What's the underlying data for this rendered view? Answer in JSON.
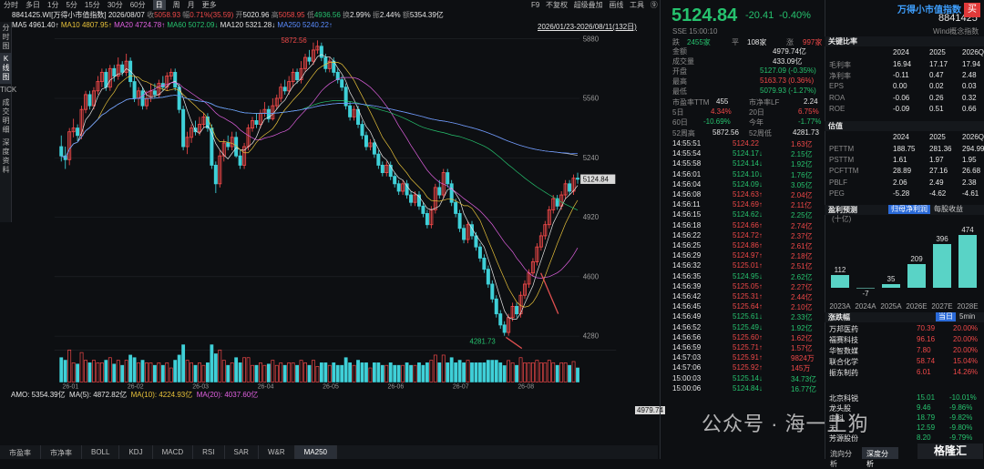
{
  "top_tabs": [
    "分时",
    "多日",
    "1分",
    "5分",
    "15分",
    "30分",
    "60分",
    "日",
    "周",
    "月",
    "更多"
  ],
  "top_right": [
    "F9",
    "不复权",
    "超级叠加",
    "画线",
    "工具",
    "⑨"
  ],
  "vertical_tabs": [
    "分时图",
    "K线图",
    "TICK",
    "成交明细",
    "深度资料"
  ],
  "info": {
    "code": "8841425.WI[万得小市值指数]",
    "date": "2026/08/07",
    "close_label": "收",
    "close": "5058.93",
    "amp_label": "幅",
    "amp": "0.71%(35.59)",
    "open_label": "开",
    "open": "5020.96",
    "high_label": "高",
    "high": "5058.95",
    "low_label": "低",
    "low": "4936.56",
    "turn_label": "换",
    "turn": "2.99%",
    "vol_label": "振",
    "vol": "2.44%",
    "amt_label": "额",
    "amt": "5354.39亿"
  },
  "ma": {
    "ma5": "MA5 4961.40↑",
    "ma10": "MA10 4807.95↑",
    "ma20": "MA20 4724.78↑",
    "ma60": "MA60 5072.09↓",
    "ma120": "MA120 5321.28↓",
    "ma250": "MA250 5240.22↑"
  },
  "range_text": "2026/01/23-2026/08/11(132日)",
  "price_levels": [
    "5880",
    "5560",
    "5240",
    "4920",
    "4600",
    "4280"
  ],
  "current_tag": "5124.84",
  "high_label": "5872.56",
  "low_label": "4281.73",
  "x_dates": [
    "26-01",
    "26-02",
    "26-03",
    "26-04",
    "26-05",
    "26-06",
    "26-07",
    "26-08"
  ],
  "amo": {
    "amo": "AMO: 5354.39亿",
    "ma5": "MA(5): 4872.82亿",
    "ma10": "MA(10): 4224.93亿",
    "ma20": "MA(20): 4037.60亿",
    "tag": "4979.74"
  },
  "bottom_tabs": [
    "市盈率",
    "市净率",
    "BOLL",
    "KDJ",
    "MACD",
    "RSI",
    "SAR",
    "W&R",
    "MA250"
  ],
  "watermark": "公众号 · 海一土狗",
  "chart_data": {
    "type": "candlestick",
    "series": [
      {
        "name": "K",
        "values": [
          [
            5300,
            5250,
            5360,
            5220
          ],
          [
            5250,
            5230,
            5300,
            5180
          ],
          [
            5230,
            5380,
            5400,
            5200
          ],
          [
            5380,
            5400,
            5450,
            5350
          ],
          [
            5400,
            5360,
            5420,
            5330
          ],
          [
            5360,
            5500,
            5520,
            5340
          ],
          [
            5500,
            5580,
            5600,
            5480
          ],
          [
            5580,
            5520,
            5600,
            5500
          ],
          [
            5520,
            5600,
            5620,
            5500
          ],
          [
            5600,
            5650,
            5680,
            5580
          ],
          [
            5650,
            5700,
            5720,
            5620
          ],
          [
            5700,
            5620,
            5720,
            5600
          ],
          [
            5620,
            5720,
            5740,
            5600
          ],
          [
            5720,
            5680,
            5740,
            5650
          ],
          [
            5680,
            5740,
            5780,
            5660
          ],
          [
            5740,
            5700,
            5760,
            5680
          ],
          [
            5700,
            5760,
            5800,
            5680
          ],
          [
            5760,
            5650,
            5780,
            5620
          ],
          [
            5650,
            5560,
            5680,
            5540
          ],
          [
            5560,
            5600,
            5620,
            5520
          ],
          [
            5600,
            5520,
            5620,
            5500
          ],
          [
            5520,
            5560,
            5600,
            5500
          ],
          [
            5560,
            5600,
            5640,
            5540
          ],
          [
            5600,
            5580,
            5640,
            5560
          ],
          [
            5580,
            5640,
            5660,
            5560
          ],
          [
            5640,
            5620,
            5680,
            5600
          ],
          [
            5620,
            5680,
            5700,
            5600
          ],
          [
            5680,
            5700,
            5720,
            5660
          ],
          [
            5700,
            5620,
            5720,
            5600
          ],
          [
            5620,
            5500,
            5640,
            5480
          ],
          [
            5500,
            5300,
            5520,
            5280
          ],
          [
            5300,
            5350,
            5380,
            5260
          ],
          [
            5350,
            5400,
            5420,
            5320
          ],
          [
            5400,
            5380,
            5440,
            5360
          ],
          [
            5380,
            5420,
            5460,
            5360
          ],
          [
            5420,
            5460,
            5480,
            5400
          ],
          [
            5460,
            5400,
            5480,
            5380
          ],
          [
            5400,
            5200,
            5420,
            5180
          ],
          [
            5200,
            5100,
            5220,
            5050
          ],
          [
            5100,
            5250,
            5280,
            5080
          ],
          [
            5250,
            5320,
            5340,
            5220
          ],
          [
            5320,
            5300,
            5360,
            5280
          ],
          [
            5300,
            5350,
            5380,
            5280
          ],
          [
            5350,
            5250,
            5380,
            5240
          ],
          [
            5250,
            5200,
            5280,
            5180
          ],
          [
            5200,
            5300,
            5320,
            5180
          ],
          [
            5300,
            5400,
            5420,
            5280
          ],
          [
            5400,
            5440,
            5460,
            5380
          ],
          [
            5440,
            5420,
            5480,
            5400
          ],
          [
            5420,
            5480,
            5500,
            5400
          ],
          [
            5480,
            5500,
            5540,
            5460
          ],
          [
            5500,
            5450,
            5520,
            5430
          ],
          [
            5450,
            5520,
            5560,
            5440
          ],
          [
            5520,
            5560,
            5580,
            5500
          ],
          [
            5560,
            5620,
            5640,
            5540
          ],
          [
            5620,
            5600,
            5660,
            5580
          ],
          [
            5600,
            5650,
            5680,
            5580
          ],
          [
            5650,
            5700,
            5720,
            5620
          ],
          [
            5700,
            5660,
            5720,
            5640
          ],
          [
            5660,
            5720,
            5760,
            5640
          ],
          [
            5720,
            5780,
            5800,
            5700
          ],
          [
            5780,
            5760,
            5820,
            5740
          ],
          [
            5760,
            5820,
            5860,
            5740
          ],
          [
            5820,
            5840,
            5872,
            5800
          ],
          [
            5840,
            5780,
            5860,
            5760
          ],
          [
            5780,
            5720,
            5800,
            5700
          ],
          [
            5720,
            5760,
            5780,
            5700
          ],
          [
            5760,
            5700,
            5780,
            5680
          ],
          [
            5700,
            5660,
            5720,
            5640
          ],
          [
            5660,
            5620,
            5680,
            5600
          ],
          [
            5620,
            5520,
            5640,
            5500
          ],
          [
            5520,
            5460,
            5540,
            5440
          ],
          [
            5460,
            5500,
            5520,
            5440
          ],
          [
            5500,
            5420,
            5520,
            5400
          ],
          [
            5420,
            5360,
            5440,
            5340
          ],
          [
            5360,
            5300,
            5380,
            5280
          ],
          [
            5300,
            5320,
            5340,
            5280
          ],
          [
            5320,
            5260,
            5340,
            5240
          ],
          [
            5260,
            5200,
            5280,
            5180
          ],
          [
            5200,
            5160,
            5220,
            5140
          ],
          [
            5160,
            5200,
            5220,
            5140
          ],
          [
            5200,
            5140,
            5220,
            5120
          ],
          [
            5140,
            5100,
            5160,
            5080
          ],
          [
            5100,
            5060,
            5120,
            5040
          ],
          [
            5060,
            5100,
            5120,
            5040
          ],
          [
            5100,
            5040,
            5120,
            5020
          ],
          [
            5040,
            5000,
            5060,
            4980
          ],
          [
            5000,
            5040,
            5060,
            4980
          ],
          [
            5040,
            4980,
            5060,
            4960
          ],
          [
            4980,
            4940,
            5000,
            4920
          ],
          [
            4940,
            4880,
            4960,
            4860
          ],
          [
            4880,
            4960,
            4980,
            4860
          ],
          [
            4960,
            5080,
            5100,
            4940
          ],
          [
            5080,
            5040,
            5120,
            5020
          ],
          [
            5040,
            5160,
            5180,
            5020
          ],
          [
            5160,
            5100,
            5180,
            5080
          ],
          [
            5100,
            5000,
            5120,
            4980
          ],
          [
            5000,
            4940,
            5020,
            4920
          ],
          [
            4940,
            4860,
            4960,
            4840
          ],
          [
            4860,
            4800,
            4880,
            4780
          ],
          [
            4800,
            4880,
            4900,
            4780
          ],
          [
            4880,
            4820,
            4900,
            4800
          ],
          [
            4820,
            4760,
            4840,
            4740
          ],
          [
            4760,
            4700,
            4780,
            4680
          ],
          [
            4700,
            4640,
            4720,
            4620
          ],
          [
            4640,
            4560,
            4660,
            4540
          ],
          [
            4560,
            4480,
            4580,
            4460
          ],
          [
            4480,
            4400,
            4500,
            4380
          ],
          [
            4400,
            4340,
            4420,
            4320
          ],
          [
            4340,
            4300,
            4360,
            4282
          ],
          [
            4300,
            4380,
            4400,
            4282
          ],
          [
            4380,
            4440,
            4460,
            4360
          ],
          [
            4440,
            4400,
            4460,
            4380
          ],
          [
            4400,
            4500,
            4520,
            4380
          ],
          [
            4500,
            4560,
            4580,
            4480
          ],
          [
            4560,
            4620,
            4640,
            4540
          ],
          [
            4620,
            4680,
            4700,
            4600
          ],
          [
            4680,
            4760,
            4780,
            4660
          ],
          [
            4760,
            4820,
            4840,
            4740
          ],
          [
            4820,
            4880,
            4900,
            4800
          ],
          [
            4880,
            4960,
            4980,
            4860
          ],
          [
            4960,
            5020,
            5040,
            4940
          ],
          [
            5020,
            4980,
            5040,
            4960
          ],
          [
            4980,
            5040,
            5060,
            4960
          ],
          [
            5040,
            5100,
            5120,
            5020
          ],
          [
            5100,
            5060,
            5120,
            5040
          ],
          [
            5060,
            5130,
            5150,
            5040
          ],
          [
            5130,
            5124.84,
            5160,
            5100
          ]
        ]
      }
    ],
    "ylim": [
      4280,
      5880
    ],
    "ylabel": "",
    "title": ""
  },
  "quote": {
    "title": "万得小市值指数",
    "code": "8841425",
    "buy_icon": "买",
    "price": "5124.84",
    "chg": "-20.41",
    "pct": "-0.40%",
    "sse": "SSE",
    "time": "15:00:10",
    "wind": "Wind概念指数"
  },
  "stats": {
    "down_label": "跌",
    "down": "2455家",
    "flat_label": "平",
    "flat": "108家",
    "up_label": "涨",
    "up": "997家",
    "amt_label": "金额",
    "amt": "4979.74亿",
    "vol_label": "成交量",
    "vol": "433.09亿",
    "open_label": "开盘",
    "open": "5127.09 (-0.35%)",
    "high_label": "最高",
    "high": "5163.73 (0.36%)",
    "low_label": "最低",
    "low": "5079.93 (-1.27%)",
    "pe_label": "市盈率TTM",
    "pe": "455",
    "pb_label": "市净率LF",
    "pb": "2.24",
    "d5_label": "5日",
    "d5": "4.34%",
    "d20_label": "20日",
    "d20": "6.75%",
    "d60_label": "60日",
    "d60": "-10.69%",
    "ytd_label": "今年",
    "ytd": "-1.77%",
    "w52h_label": "52周高",
    "w52h": "5872.56",
    "w52l_label": "52周低",
    "w52l": "4281.73"
  },
  "ticks": [
    [
      "14:55:51",
      "5124.22",
      "1.63亿",
      "red"
    ],
    [
      "14:55:54",
      "5124.17↓",
      "2.15亿",
      "green"
    ],
    [
      "14:55:58",
      "5124.14↓",
      "1.92亿",
      "green"
    ],
    [
      "14:56:01",
      "5124.10↓",
      "1.76亿",
      "green"
    ],
    [
      "14:56:04",
      "5124.09↓",
      "3.05亿",
      "green"
    ],
    [
      "14:56:08",
      "5124.63↑",
      "2.04亿",
      "red"
    ],
    [
      "14:56:11",
      "5124.69↑",
      "2.11亿",
      "red"
    ],
    [
      "14:56:15",
      "5124.62↓",
      "2.25亿",
      "green"
    ],
    [
      "14:56:18",
      "5124.66↑",
      "2.74亿",
      "red"
    ],
    [
      "14:56:22",
      "5124.72↑",
      "2.37亿",
      "red"
    ],
    [
      "14:56:25",
      "5124.86↑",
      "2.61亿",
      "red"
    ],
    [
      "14:56:29",
      "5124.97↑",
      "2.18亿",
      "red"
    ],
    [
      "14:56:32",
      "5125.01↑",
      "2.51亿",
      "red"
    ],
    [
      "14:56:35",
      "5124.95↓",
      "2.62亿",
      "green"
    ],
    [
      "14:56:39",
      "5125.05↑",
      "2.27亿",
      "red"
    ],
    [
      "14:56:42",
      "5125.31↑",
      "2.44亿",
      "red"
    ],
    [
      "14:56:45",
      "5125.64↑",
      "2.10亿",
      "red"
    ],
    [
      "14:56:49",
      "5125.61↓",
      "2.33亿",
      "green"
    ],
    [
      "14:56:52",
      "5125.49↓",
      "1.92亿",
      "green"
    ],
    [
      "14:56:56",
      "5125.60↑",
      "1.62亿",
      "red"
    ],
    [
      "14:56:59",
      "5125.71↑",
      "1.57亿",
      "red"
    ],
    [
      "14:57:03",
      "5125.91↑",
      "9824万",
      "red"
    ],
    [
      "14:57:06",
      "5125.92↑",
      "145万",
      "red"
    ],
    [
      "15:00:03",
      "5125.14↓",
      "34.73亿",
      "green"
    ],
    [
      "15:00:06",
      "5124.84↓",
      "16.77亿",
      "green"
    ]
  ],
  "right": {
    "key_title": "关键比率",
    "years": [
      "2024",
      "2025",
      "2026Q1"
    ],
    "ratios": [
      [
        "毛利率",
        "16.94",
        "17.17",
        "17.94"
      ],
      [
        "净利率",
        "-0.11",
        "0.47",
        "2.48"
      ],
      [
        "EPS",
        "0.00",
        "0.02",
        "0.03"
      ],
      [
        "ROA",
        "-0.06",
        "0.26",
        "0.32"
      ],
      [
        "ROE",
        "-0.09",
        "0.51",
        "0.66"
      ]
    ],
    "val_title": "估值",
    "val_years": [
      "2024",
      "2025",
      "2026Q1"
    ],
    "vals": [
      [
        "PETTM",
        "188.75",
        "281.36",
        "294.99"
      ],
      [
        "PSTTM",
        "1.61",
        "1.97",
        "1.95"
      ],
      [
        "PCFTTM",
        "28.89",
        "27.16",
        "26.68"
      ],
      [
        "PBLF",
        "2.06",
        "2.49",
        "2.38"
      ],
      [
        "PEG",
        "-5.28",
        "-4.62",
        "-4.61"
      ]
    ],
    "profit_title": "盈利预测",
    "profit_unit": "(十亿)",
    "profit_btn1": "归母净利润",
    "profit_btn2": "每股收益",
    "profit_bars": [
      [
        "2023A",
        "112"
      ],
      [
        "2024A",
        "-7"
      ],
      [
        "2025A",
        "35"
      ],
      [
        "2026E",
        "209"
      ],
      [
        "2027E",
        "396"
      ],
      [
        "2028E",
        "474"
      ]
    ],
    "rise_title": "涨跌幅",
    "rise_btn1": "当日",
    "rise_btn2": "5min",
    "rise": [
      [
        "万邦医药",
        "70.39",
        "20.00%"
      ],
      [
        "福赛科技",
        "96.16",
        "20.00%"
      ],
      [
        "华智数媒",
        "7.80",
        "20.00%"
      ],
      [
        "联合化学",
        "58.74",
        "15.04%"
      ],
      [
        "振东制药",
        "6.01",
        "14.26%"
      ]
    ],
    "fall": [
      [
        "北京科锐",
        "15.01",
        "-10.01%"
      ],
      [
        "龙头股",
        "9.46",
        "-9.86%"
      ],
      [
        "中科",
        "18.79",
        "-9.82%"
      ],
      [
        "天",
        "12.59",
        "-9.80%"
      ],
      [
        "芳源股份",
        "8.20",
        "-9.79%"
      ]
    ],
    "bottom_tabs": [
      "流向分析",
      "深度分析"
    ],
    "logo": "格隆汇"
  }
}
